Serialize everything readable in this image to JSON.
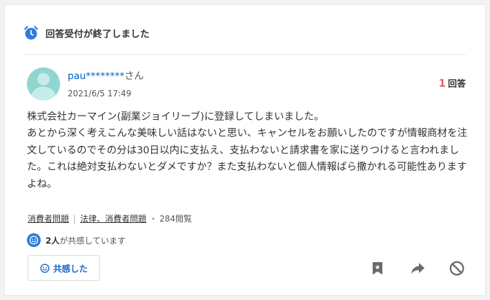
{
  "status": {
    "text": "回答受付が終了しました",
    "icon": "alarm-clock-icon"
  },
  "question": {
    "user": {
      "name": "pau********",
      "suffix": "さん"
    },
    "date": "2021/6/5 17:49",
    "answers": {
      "count": "1",
      "label": "回答"
    },
    "body": "株式会社カーマイン(副業ジョイリーブ)に登録してしまいました。\nあとから深く考えこんな美味しい話はないと思い、キャンセルをお願いしたのですが情報商材を注文しているのでその分は30日以内に支払え、支払わないと請求書を家に送りつけると言われました。これは絶対支払わないとダメですか？また支払わないと個人情報ばら撒かれる可能性ありますよね。",
    "categories": [
      {
        "label": "消費者問題"
      },
      {
        "label": "法律、消費者問題"
      }
    ],
    "views": "284閲覧",
    "empathy": {
      "count": "2人",
      "text": "が共感しています"
    }
  },
  "actions": {
    "empathy_button": "共感した",
    "icons": [
      "bookmark-icon",
      "share-icon",
      "block-icon"
    ]
  },
  "colors": {
    "accent": "#2f7bd8",
    "link": "#0064c8",
    "answer_count": "#ea5f5f"
  }
}
